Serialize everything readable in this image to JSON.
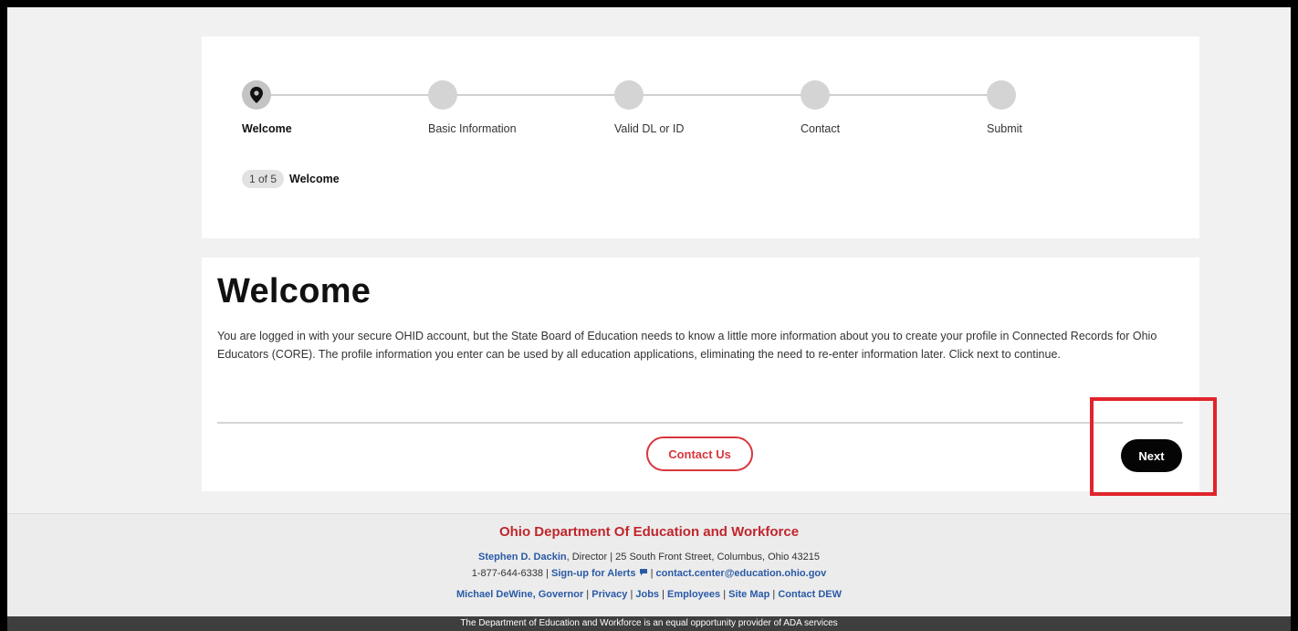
{
  "stepper": {
    "steps": [
      {
        "label": "Welcome",
        "active": true
      },
      {
        "label": "Basic Information",
        "active": false
      },
      {
        "label": "Valid DL or ID",
        "active": false
      },
      {
        "label": "Contact",
        "active": false
      },
      {
        "label": "Submit",
        "active": false
      }
    ],
    "counter": "1 of 5",
    "current_title": "Welcome"
  },
  "welcome": {
    "title": "Welcome",
    "body": "You are logged in with your secure OHID account, but the State Board of Education needs to know a little more information about you to create your profile in Connected Records for Ohio Educators (CORE). The profile information you enter can be used by all education applications, eliminating the need to re-enter information later. Click next to continue.",
    "contact_button": "Contact Us",
    "next_button": "Next"
  },
  "footer": {
    "title": "Ohio Department Of Education and Workforce",
    "director_name": "Stephen D. Dackin",
    "director_rest": ", Director | 25 South Front Street, Columbus, Ohio 43215",
    "phone": "1-877-644-6338 | ",
    "alerts_link": "Sign-up for Alerts",
    "separator": " | ",
    "email_link": "contact.center@education.ohio.gov",
    "links": [
      "Michael DeWine, Governor",
      "Privacy",
      "Jobs",
      "Employees",
      "Site Map",
      "Contact DEW"
    ],
    "link_separator": " | ",
    "bottom_bar": "The Department of Education and Workforce is an equal opportunity provider of ADA services"
  },
  "colors": {
    "accent_red": "#d9363e",
    "highlight_red": "#e0242b",
    "link_blue": "#2a5aa6",
    "next_button_bg": "#050505"
  },
  "icons": {
    "active_step": "map-pin-icon",
    "alerts": "chat-bubble-icon"
  }
}
